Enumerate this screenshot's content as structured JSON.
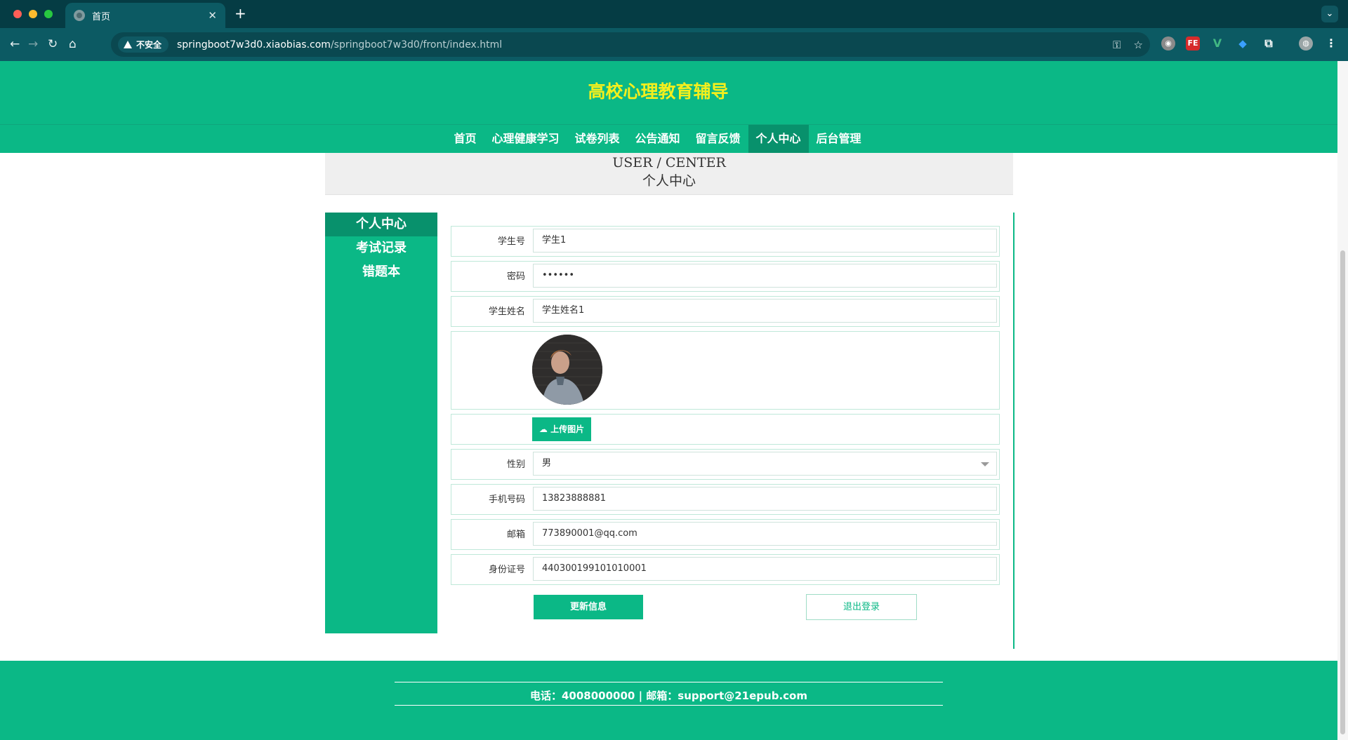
{
  "browser": {
    "tab_title": "首页",
    "tab_close": "✕",
    "new_tab": "+",
    "url_security_label": "不安全",
    "url_host": "springboot7w3d0.xiaobias.com",
    "url_path": "/springboot7w3d0/front/index.html",
    "ext_fe": "FE",
    "ext_v": "V"
  },
  "header": {
    "title": "高校心理教育辅导"
  },
  "nav": {
    "items": [
      {
        "label": "首页"
      },
      {
        "label": "心理健康学习"
      },
      {
        "label": "试卷列表"
      },
      {
        "label": "公告通知"
      },
      {
        "label": "留言反馈"
      },
      {
        "label": "个人中心"
      },
      {
        "label": "后台管理"
      }
    ],
    "active": "个人中心"
  },
  "banner": {
    "en": "USER / CENTER",
    "cn": "个人中心"
  },
  "sidebar": {
    "items": [
      {
        "label": "个人中心"
      },
      {
        "label": "考试记录"
      },
      {
        "label": "错题本"
      }
    ]
  },
  "form": {
    "student_no": {
      "label": "学生号",
      "value": "学生1"
    },
    "password": {
      "label": "密码",
      "value": "••••••"
    },
    "student_name": {
      "label": "学生姓名",
      "value": "学生姓名1"
    },
    "upload_label": "上传图片",
    "gender": {
      "label": "性别",
      "value": "男"
    },
    "phone": {
      "label": "手机号码",
      "value": "13823888881"
    },
    "email": {
      "label": "邮箱",
      "value": "773890001@qq.com"
    },
    "id_card": {
      "label": "身份证号",
      "value": "440300199101010001"
    }
  },
  "buttons": {
    "update": "更新信息",
    "logout": "退出登录"
  },
  "footer": {
    "text": "电话：4008000000 | 邮箱：support@21epub.com"
  },
  "colors": {
    "brand_green": "#0bb886",
    "active_green": "#08916c",
    "title_yellow": "#f4ef1d",
    "chrome_dark": "#053c44",
    "chrome_toolbar": "#0c5a63"
  }
}
